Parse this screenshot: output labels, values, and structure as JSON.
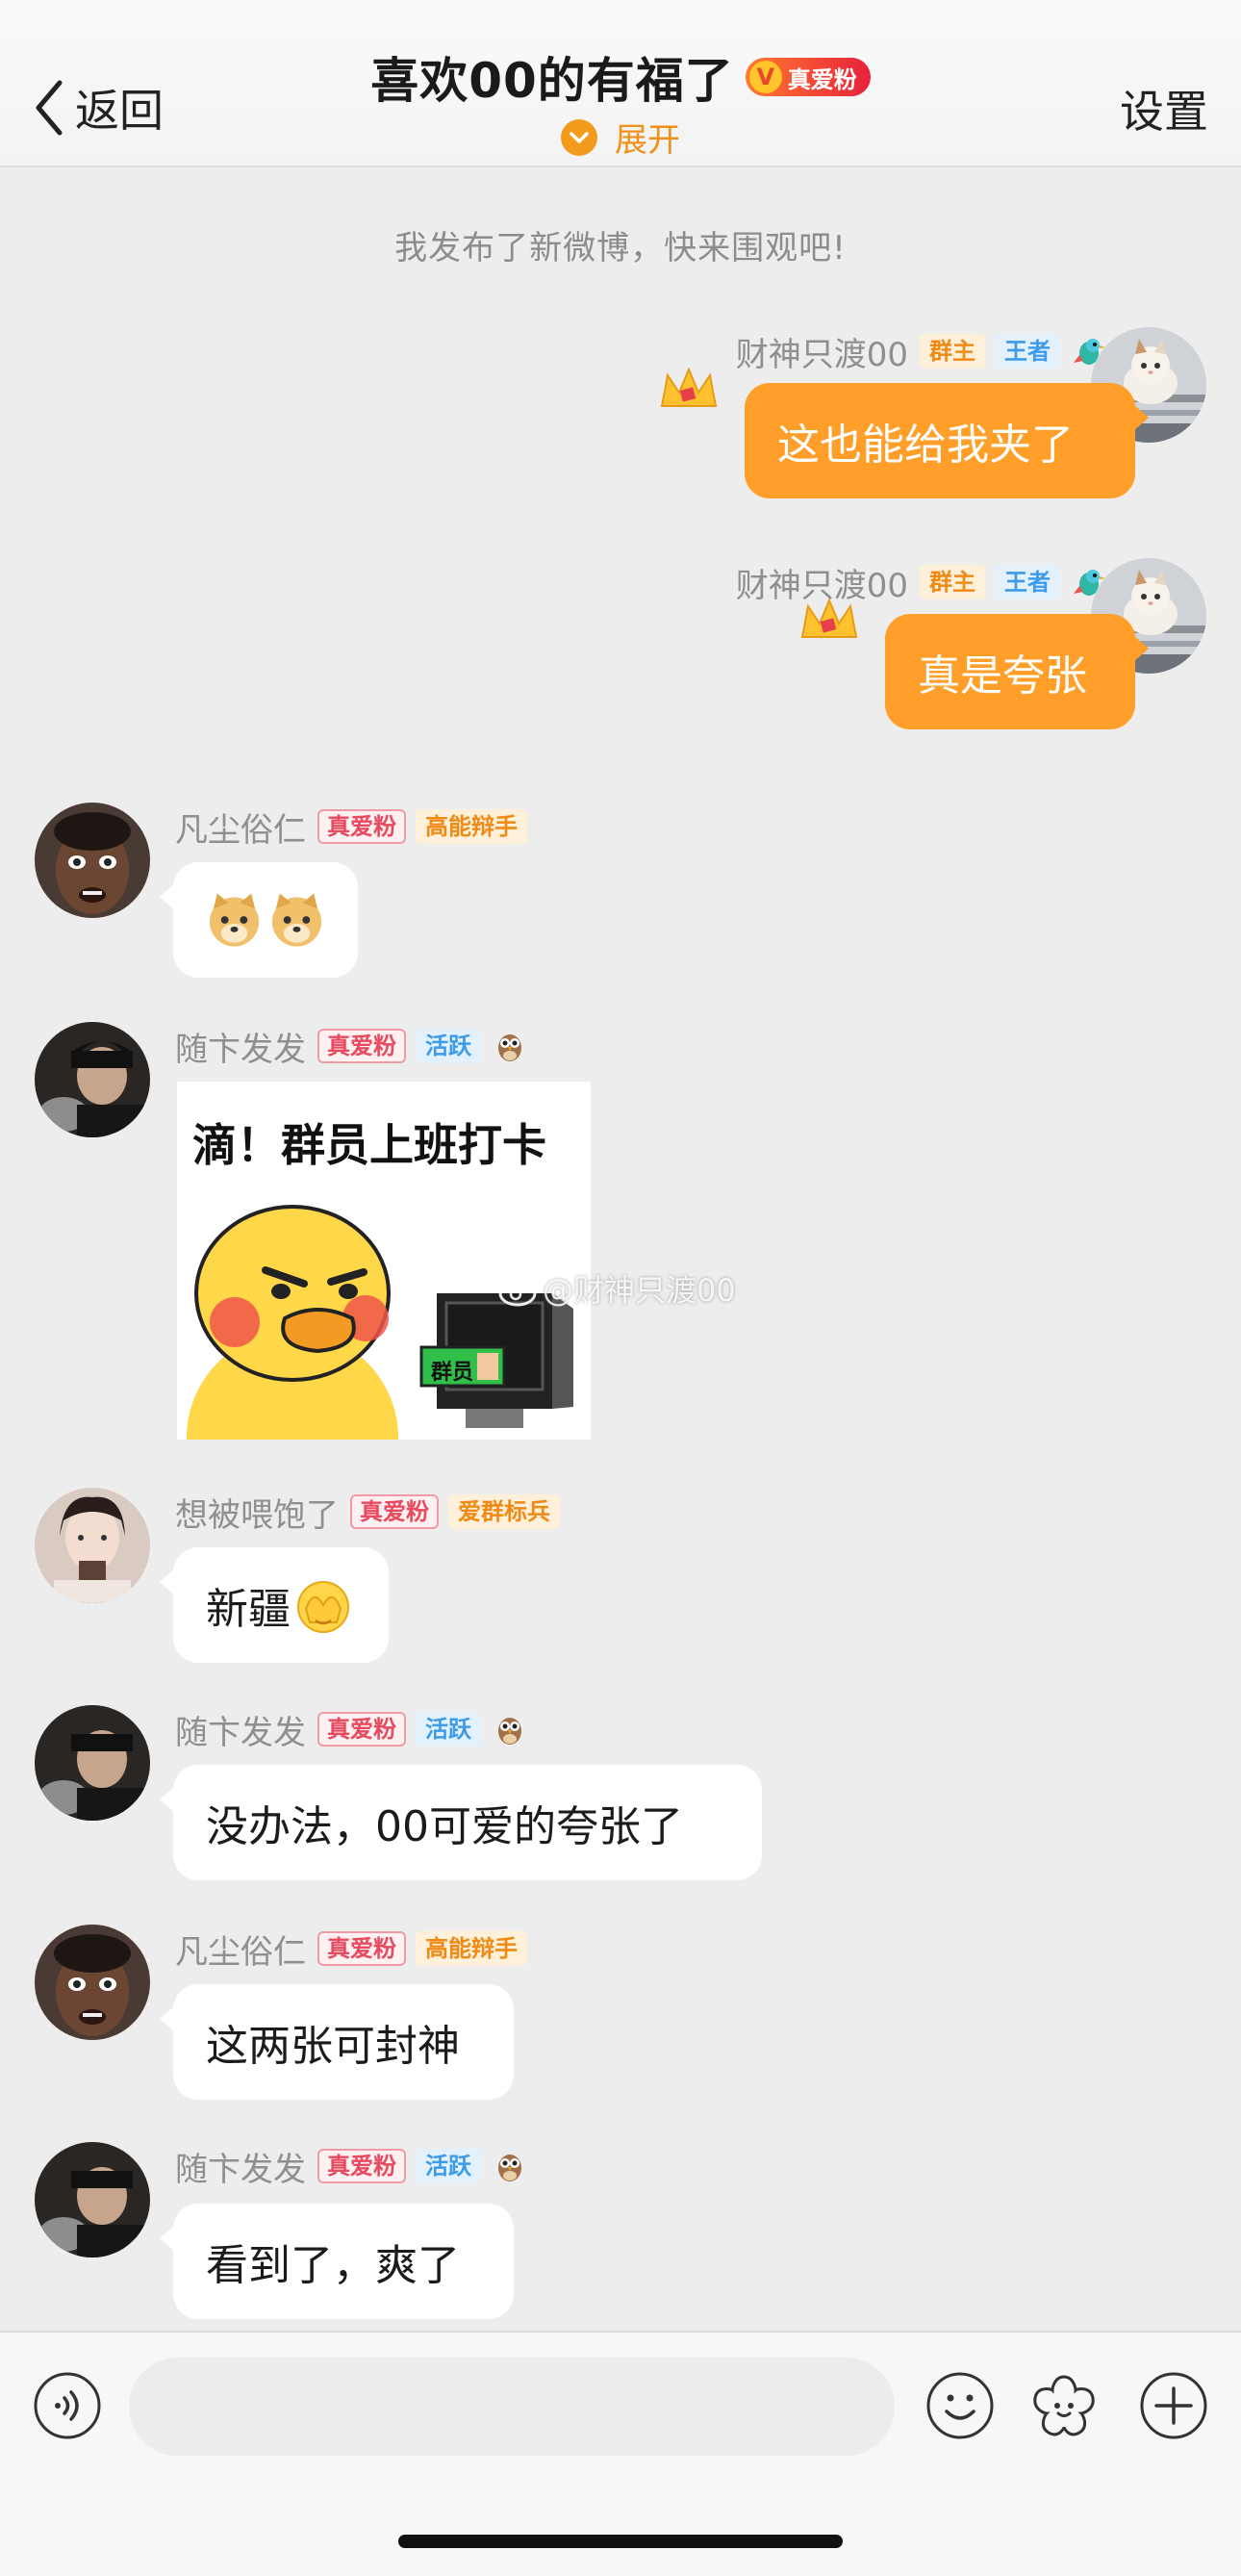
{
  "header": {
    "back_label": "返回",
    "title": "喜欢00的有福了",
    "fan_badge_letter": "V",
    "fan_badge_text": "真爱粉",
    "expand_label": "展开",
    "settings_label": "设置"
  },
  "notice": "我发布了新微博，快来围观吧!",
  "tags": {
    "owner": "群主",
    "king": "王者",
    "fan": "真爱粉",
    "debater": "高能辩手",
    "active": "活跃",
    "flag": "爱群标兵"
  },
  "messages": [
    {
      "sender": "财神只渡00",
      "text": "这也能给我夹了",
      "side": "right"
    },
    {
      "sender": "财神只渡00",
      "text": "真是夸张",
      "side": "right"
    },
    {
      "sender": "凡尘俗仁",
      "text": "",
      "emoji": "doge-doge",
      "side": "left"
    },
    {
      "sender": "随卞发发",
      "sticker_text": "滴！群员上班打卡",
      "sticker_card_text": "群员",
      "side": "left"
    },
    {
      "sender": "想被喂饱了",
      "text": "新疆",
      "emoji": "facepalm",
      "side": "left"
    },
    {
      "sender": "随卞发发",
      "text": "没办法，00可爱的夸张了",
      "side": "left"
    },
    {
      "sender": "凡尘俗仁",
      "text": "这两张可封神",
      "side": "left"
    },
    {
      "sender": "随卞发发",
      "text": "看到了，爽了",
      "side": "left"
    }
  ],
  "watermark": "@财神只渡00",
  "input": {
    "placeholder": ""
  },
  "icons": {
    "back": "chevron-left-icon",
    "expand": "chevron-down-circle-icon",
    "voice": "voice-icon",
    "emoji": "smiley-icon",
    "sticker": "flower-sticker-icon",
    "plus": "plus-icon"
  },
  "colors": {
    "accent": "#ff9f2a",
    "background": "#ededed",
    "fan_red": "#e84a5f",
    "gold": "#f08a16",
    "blue": "#3d9be8"
  }
}
